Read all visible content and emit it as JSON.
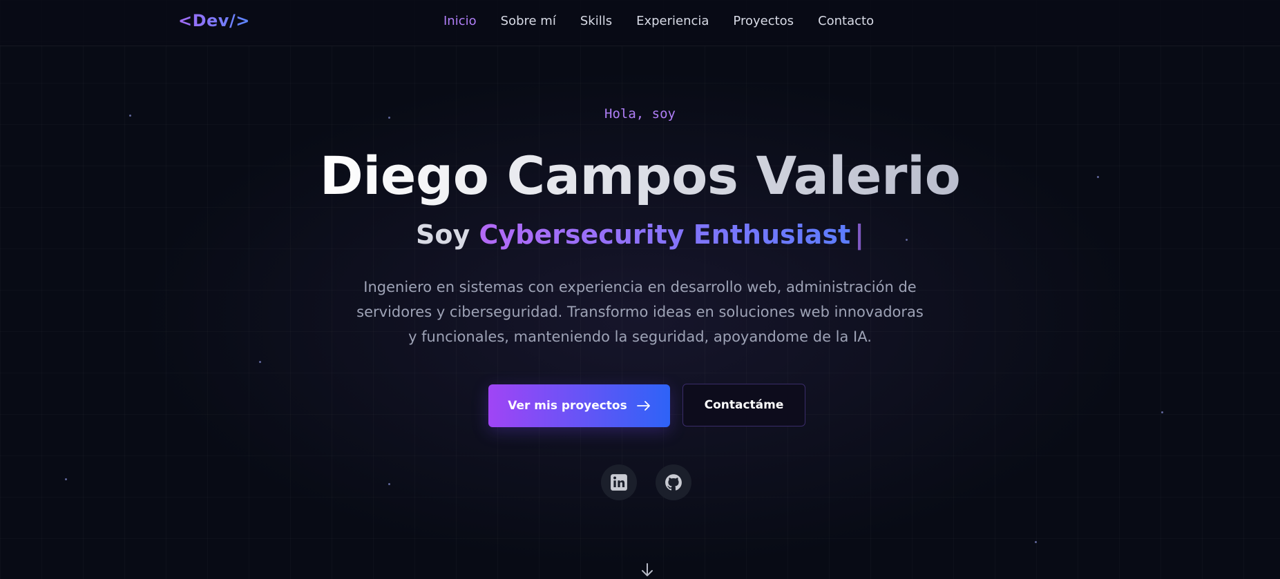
{
  "nav": {
    "logo": "<Dev/>",
    "links": [
      {
        "label": "Inicio",
        "active": true
      },
      {
        "label": "Sobre mí",
        "active": false
      },
      {
        "label": "Skills",
        "active": false
      },
      {
        "label": "Experiencia",
        "active": false
      },
      {
        "label": "Proyectos",
        "active": false
      },
      {
        "label": "Contacto",
        "active": false
      }
    ]
  },
  "hero": {
    "greeting": "Hola, soy",
    "name": "Diego Campos Valerio",
    "role_prefix": "Soy",
    "role": "Cybersecurity Enthusiast",
    "cursor": "|",
    "description": "Ingeniero en sistemas con experiencia en desarrollo web, administración de servidores y ciberseguridad. Transformo ideas en soluciones web innovadoras y funcionales, manteniendo la seguridad, apoyandome de la IA.",
    "primary_button": "Ver mis proyectos",
    "secondary_button": "Contactáme"
  },
  "social": [
    {
      "icon": "linkedin-icon"
    },
    {
      "icon": "github-icon"
    }
  ],
  "scroll": {
    "icon": "arrow-down-icon"
  },
  "colors": {
    "background": "#080b15",
    "accent_purple": "#b07ff7",
    "accent_blue": "#2e63f7",
    "text_muted": "#9ea3b6"
  }
}
